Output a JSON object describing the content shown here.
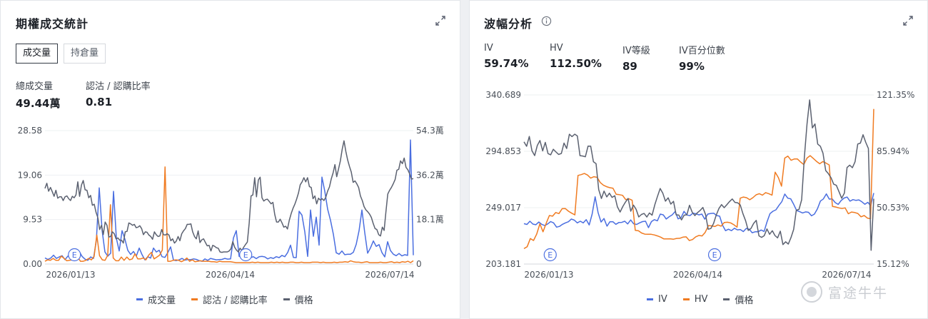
{
  "left_panel": {
    "title": "期權成交統計",
    "tabs": [
      "成交量",
      "持倉量"
    ],
    "stats": [
      {
        "label": "總成交量",
        "value": "49.44萬"
      },
      {
        "label": "認沽 / 認購比率",
        "value": "0.81"
      }
    ],
    "legend": [
      {
        "name": "成交量",
        "color": "#4a6ee0"
      },
      {
        "name": "認沽 / 認購比率",
        "color": "#f07b21"
      },
      {
        "name": "價格",
        "color": "#5b6170"
      }
    ]
  },
  "right_panel": {
    "title": "波幅分析",
    "stats": [
      {
        "label": "IV",
        "value": "59.74%"
      },
      {
        "label": "HV",
        "value": "112.50%"
      },
      {
        "label": "IV等級",
        "value": "89"
      },
      {
        "label": "IV百分位數",
        "value": "99%"
      }
    ],
    "legend": [
      {
        "name": "IV",
        "color": "#4a6ee0"
      },
      {
        "name": "HV",
        "color": "#f07b21"
      },
      {
        "name": "價格",
        "color": "#5b6170"
      }
    ]
  },
  "watermark": "富途牛牛",
  "chart_data": [
    {
      "type": "line",
      "x_ticks": [
        "2026/01/13",
        "2026/04/14",
        "2026/07/14"
      ],
      "y_left_ticks": [
        "0.00",
        "9.53",
        "19.06",
        "28.58"
      ],
      "y_right_ticks": [
        "0",
        "18.1萬",
        "36.2萬",
        "54.3萬"
      ],
      "ylim_left": [
        0,
        28.58
      ],
      "ylim_right": [
        0,
        54.3
      ],
      "earnings_markers": [
        {
          "label": "E",
          "t": 0.08
        },
        {
          "label": "E",
          "t": 0.545
        }
      ],
      "series": [
        {
          "name": "成交量",
          "axis": "right",
          "color": "#4a6ee0",
          "values": [
            2.5,
            1.9,
            2.4,
            3.6,
            2.3,
            2.9,
            3.4,
            1.8,
            3.2,
            3.7,
            2.6,
            4.2,
            5.1,
            3.1,
            2.0,
            1.5,
            2.9,
            2.3,
            9.7,
            31.0,
            13.8,
            4.9,
            3.2,
            4.4,
            29.6,
            10.5,
            5.3,
            13.6,
            10.1,
            5.6,
            3.9,
            5.1,
            3.3,
            6.5,
            3.8,
            1.7,
            3.0,
            2.4,
            6.5,
            4.9,
            5.6,
            3.0,
            2.7,
            4.6,
            7.0,
            1.6,
            1.4,
            1.7,
            2.3,
            1.6,
            1.8,
            1.8,
            2.1,
            1.9,
            1.4,
            1.1,
            2.1,
            1.5,
            2.3,
            2.0,
            1.7,
            1.8,
            1.9,
            2.3,
            2.0,
            2.1,
            10.6,
            13.6,
            3.1,
            3.1,
            2.9,
            2.5,
            2.6,
            3.0,
            2.2,
            3.0,
            3.1,
            2.9,
            2.1,
            2.6,
            2.3,
            3.0,
            2.6,
            3.5,
            3.0,
            4.7,
            7.7,
            2.7,
            2.6,
            21.5,
            19.9,
            13.1,
            3.1,
            22.0,
            11.3,
            19.1,
            7.7,
            35.4,
            29.6,
            22.3,
            17.8,
            12.1,
            4.6,
            4.0,
            5.3,
            3.8,
            4.0,
            4.0,
            4.8,
            8.0,
            13.6,
            22.0,
            12.7,
            4.4,
            6.6,
            9.4,
            7.2,
            7.9,
            4.7,
            2.9,
            9.1,
            5.5,
            4.0,
            3.4,
            4.3,
            3.3,
            3.8,
            3.5,
            50.5,
            3.6
          ]
        },
        {
          "name": "認沽 / 認購比率",
          "axis": "left",
          "color": "#f07b21",
          "values": [
            0.6,
            0.9,
            0.8,
            1.2,
            0.8,
            0.8,
            1.7,
            1.2,
            0.7,
            0.8,
            0.9,
            0.9,
            1.5,
            0.6,
            0.6,
            0.8,
            1.2,
            0.9,
            1.6,
            6.2,
            1.8,
            0.9,
            0.8,
            1.9,
            12.7,
            1.3,
            0.7,
            0.7,
            1.5,
            0.8,
            1.5,
            0.9,
            1.1,
            2.2,
            1.1,
            1.1,
            1.3,
            0.9,
            1.9,
            2.5,
            1.1,
            1.5,
            1.9,
            3.0,
            20.8,
            0.6,
            0.6,
            0.8,
            0.9,
            0.8,
            0.5,
            0.8,
            1.3,
            0.6,
            0.9,
            0.5,
            0.6,
            0.7,
            0.6,
            0.6,
            0.6,
            0.5,
            0.5,
            0.4,
            0.6,
            0.5,
            0.5,
            0.5,
            0.5,
            0.4,
            0.3,
            0.3,
            0.3,
            0.3,
            0.3,
            0.3,
            0.4,
            0.3,
            0.4,
            0.3,
            0.3,
            0.3,
            0.3,
            0.4,
            0.3,
            0.4,
            0.3,
            0.4,
            0.3,
            0.3,
            0.4,
            0.4,
            0.3,
            0.3,
            0.4,
            0.3,
            0.3,
            0.3,
            0.4,
            0.4,
            0.4,
            0.3,
            0.4,
            0.3,
            0.3,
            0.3,
            0.4,
            0.3,
            0.4,
            0.4,
            0.5,
            0.4,
            0.7,
            0.5,
            0.4,
            0.4,
            0.3,
            0.4,
            0.5,
            0.3,
            0.3,
            0.3,
            0.3,
            0.4,
            0.3,
            0.3,
            0.4,
            0.5,
            0.3,
            0.4,
            0.3,
            0.5,
            0.4,
            0.6,
            0.3,
            0.7
          ]
        },
        {
          "name": "價格",
          "axis": "left",
          "color": "#5b6170",
          "values": [
            16.2,
            17.3,
            15.6,
            16.4,
            15.5,
            14.5,
            15.8,
            14.1,
            14.4,
            14.4,
            13.6,
            14.4,
            14.6,
            14.0,
            13.6,
            14.5,
            14.2,
            14.8,
            17.6,
            14.5,
            16.9,
            17.9,
            15.9,
            15.8,
            14.2,
            14.7,
            12.6,
            12.8,
            11.1,
            9.9,
            7.4,
            8.3,
            6.3,
            9.0,
            8.3,
            5.8,
            5.9,
            6.9,
            6.5,
            5.4,
            5.6,
            5.1,
            5.1,
            4.5,
            6.9,
            7.0,
            8.8,
            8.6,
            8.3,
            8.5,
            7.8,
            7.9,
            8.2,
            7.6,
            6.3,
            6.9,
            6.8,
            6.2,
            5.9,
            5.3,
            6.9,
            6.3,
            5.9,
            6.0,
            7.4,
            6.3,
            6.2,
            6.5,
            6.2,
            5.0,
            5.4,
            4.5,
            4.9,
            5.9,
            5.0,
            6.5,
            7.1,
            7.6,
            8.5,
            8.5,
            8.6,
            6.9,
            5.9,
            5.4,
            7.1,
            4.6,
            5.2,
            5.4,
            4.6,
            3.9,
            4.0,
            2.8,
            4.0,
            3.8,
            3.5,
            3.4,
            2.6,
            2.5,
            2.6,
            2.6,
            2.6,
            2.8,
            3.3,
            4.8,
            3.6,
            3.0,
            2.6,
            3.4,
            2.9,
            3.6,
            4.2,
            4.7,
            8.8,
            14.6,
            14.8,
            18.5,
            14.4,
            18.0,
            18.6,
            14.2,
            13.5,
            13.8,
            13.9,
            13.4,
            12.9,
            13.2,
            10.6,
            9.0,
            9.0,
            9.6,
            8.8,
            7.9,
            8.1,
            7.5,
            9.4,
            10.8,
            11.9,
            12.8,
            13.9,
            15.2,
            17.0,
            17.6,
            18.5,
            17.6,
            18.5,
            16.6,
            16.4,
            14.0,
            14.6,
            12.9,
            14.1,
            13.7,
            14.0,
            13.6,
            14.3,
            15.6,
            16.5,
            18.2,
            19.5,
            21.3,
            18.7,
            20.4,
            22.1,
            24.6,
            26.4,
            24.1,
            22.3,
            20.9,
            19.7,
            17.5,
            17.8,
            17.2,
            16.4,
            14.6,
            13.6,
            12.3,
            11.6,
            11.2,
            10.7,
            10.0,
            8.7,
            7.6,
            7.4,
            6.3,
            6.0,
            7.9,
            7.2,
            11.3,
            15.0,
            15.8,
            16.4,
            17.2,
            18.1,
            20.1,
            20.3,
            22.1,
            21.5,
            22.7,
            20.7,
            20.2,
            19.3,
            18.2,
            18.3
          ]
        }
      ]
    },
    {
      "type": "line",
      "x_ticks": [
        "2026/01/13",
        "2026/04/14",
        "2026/07/14"
      ],
      "y_left_ticks": [
        "203.181",
        "249.017",
        "294.853",
        "340.689"
      ],
      "y_right_ticks": [
        "15.12%",
        "50.53%",
        "85.94%",
        "121.35%"
      ],
      "ylim_left": [
        203.181,
        340.689
      ],
      "ylim_right": [
        15.12,
        121.35
      ],
      "earnings_markers": [
        {
          "label": "E",
          "t": 0.075
        },
        {
          "label": "E",
          "t": 0.545
        }
      ],
      "series": [
        {
          "name": "IV",
          "axis": "right",
          "color": "#4a6ee0",
          "values": [
            40.5,
            40.0,
            42.0,
            40.2,
            39.8,
            41.5,
            40.1,
            39.3,
            40.3,
            41.8,
            41.0,
            38.3,
            38.8,
            40.1,
            41.0,
            41.7,
            43.4,
            42.7,
            41.0,
            42.0,
            41.0,
            43.0,
            39.7,
            46.5,
            57.4,
            47.5,
            41.5,
            43.7,
            38.9,
            41.7,
            41.7,
            40.1,
            41.2,
            41.3,
            42.0,
            40.3,
            42.8,
            40.4,
            40.0,
            41.0,
            41.8,
            42.0,
            38.0,
            41.8,
            43.0,
            42.3,
            46.5,
            46.0,
            43.4,
            44.9,
            46.0,
            48.1,
            43.5,
            44.3,
            48.2,
            45.9,
            45.5,
            47.1,
            46.7,
            46.0,
            46.5,
            43.3,
            46.5,
            46.9,
            47.1,
            45.6,
            45.2,
            39.5,
            36.1,
            37.0,
            36.1,
            37.6,
            36.6,
            36.8,
            35.5,
            37.5,
            37.0,
            34.8,
            35.4,
            35.4,
            36.5,
            35.6,
            41.6,
            46.8,
            48.3,
            49.2,
            51.9,
            54.4,
            59.1,
            56.5,
            56.1,
            52.6,
            48.7,
            48.0,
            47.2,
            47.9,
            47.6,
            45.4,
            46.5,
            49.8,
            54.7,
            56.0,
            59.2,
            55.9,
            56.0,
            53.7,
            52.6,
            55.0,
            56.6,
            57.2,
            54.6,
            55.6,
            55.1,
            55.4,
            54.2,
            52.7,
            53.9,
            51.7,
            59.7
          ]
        },
        {
          "name": "HV",
          "axis": "right",
          "color": "#f07b21",
          "values": [
            24.8,
            26.0,
            31.1,
            29.9,
            33.9,
            40.4,
            35.4,
            40.8,
            45.6,
            45.2,
            47.5,
            46.8,
            49.9,
            50.0,
            48.3,
            47.1,
            46.0,
            70.8,
            71.3,
            72.0,
            71.0,
            69.1,
            70.0,
            69.6,
            66.3,
            64.6,
            63.7,
            63.1,
            62.7,
            58.9,
            58.7,
            58.3,
            55.6,
            56.1,
            55.2,
            36.3,
            36.0,
            34.6,
            33.9,
            33.8,
            33.8,
            33.4,
            32.8,
            32.0,
            30.9,
            30.9,
            31.0,
            30.7,
            31.2,
            31.3,
            32.0,
            32.2,
            29.9,
            30.5,
            32.2,
            33.1,
            32.8,
            35.0,
            39.3,
            39.1,
            38.7,
            39.7,
            38.9,
            41.2,
            41.4,
            41.0,
            39.8,
            38.3,
            56.5,
            57.2,
            56.8,
            55.5,
            56.8,
            58.6,
            59.3,
            58.4,
            60.0,
            59.3,
            58.4,
            72.8,
            69.4,
            64.0,
            81.7,
            82.9,
            80.3,
            81.1,
            81.1,
            79.2,
            77.6,
            81.7,
            83.2,
            81.4,
            79.6,
            78.1,
            79.5,
            78.5,
            77.4,
            51.4,
            51.0,
            50.4,
            50.0,
            50.4,
            46.7,
            47.8,
            47.5,
            46.9,
            44.8,
            45.6,
            44.0,
            43.6,
            112.5
          ]
        },
        {
          "name": "價格",
          "axis": "left",
          "color": "#5b6170",
          "values": [
            302.5,
            298.9,
            306.9,
            295.3,
            291.4,
            299.6,
            303.6,
            295.2,
            302.1,
            293.0,
            292.0,
            296.5,
            294.3,
            292.3,
            293.1,
            301.5,
            297.1,
            308.7,
            306.8,
            308.8,
            307.3,
            291.3,
            291.0,
            290.4,
            299.1,
            299.0,
            286.4,
            284.8,
            263.7,
            256.5,
            262.5,
            257.8,
            260.8,
            257.4,
            258.7,
            249.7,
            245.5,
            249.9,
            253.5,
            256.5,
            246.1,
            251.1,
            247.7,
            241.5,
            243.5,
            244.3,
            241.4,
            244.7,
            242.9,
            251.4,
            258.1,
            264.6,
            260.8,
            254.3,
            257.0,
            251.9,
            254.2,
            243.2,
            243.0,
            239.1,
            242.9,
            243.2,
            251.0,
            245.4,
            242.6,
            245.0,
            246.8,
            249.2,
            243.4,
            231.5,
            232.1,
            236.2,
            242.9,
            248.3,
            251.5,
            249.0,
            251.5,
            254.0,
            256.1,
            253.3,
            253.0,
            251.2,
            244.2,
            238.4,
            230.5,
            232.0,
            236.2,
            238.7,
            226.1,
            224.9,
            226.3,
            231.7,
            227.4,
            230.3,
            226.4,
            224.5,
            229.9,
            219.0,
            221.3,
            219.4,
            224.6,
            231.3,
            246.9,
            247.6,
            255.4,
            289.2,
            316.9,
            336.6,
            313.9,
            317.1,
            300.7,
            299.0,
            293.3,
            279.2,
            276.7,
            273.3,
            268.1,
            267.2,
            261.9,
            256.7,
            260.9,
            281.7,
            283.6,
            281.5,
            286.3,
            300.8,
            301.5,
            308.3,
            302.1,
            297.1,
            214.4,
            256.3
          ]
        }
      ]
    }
  ]
}
